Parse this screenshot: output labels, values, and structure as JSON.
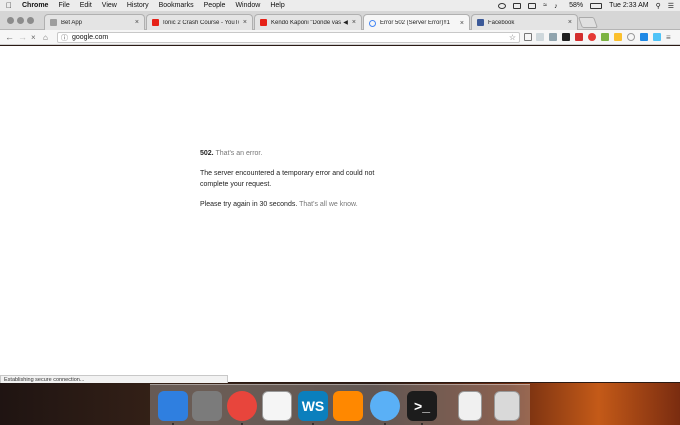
{
  "menubar": {
    "app": "Chrome",
    "menus": [
      "File",
      "Edit",
      "View",
      "History",
      "Bookmarks",
      "People",
      "Window",
      "Help"
    ],
    "battery": "58%",
    "clock": "Tue 2:33 AM"
  },
  "tabs": [
    {
      "title": "Bet App",
      "favicon_color": "#9e9e9e"
    },
    {
      "title": "Ionic 2 Crash Course - YouTub",
      "favicon_color": "#e62117"
    },
    {
      "title": "Kendo Kaponi \"Donde vas c",
      "favicon_color": "#e62117"
    },
    {
      "title": "Error 502 (Server Error)!!1",
      "favicon_color": "#4285f4",
      "active": true
    },
    {
      "title": "Facebook",
      "favicon_color": "#3b5998"
    }
  ],
  "toolbar": {
    "url": "google.com"
  },
  "error": {
    "code": "502.",
    "code_note": "That's an error.",
    "message": "The server encountered a temporary error and could not complete your request.",
    "retry": "Please try again in 30 seconds.",
    "retry_note": "That's all we know."
  },
  "status_bar": "Establishing secure connection...",
  "dock": {
    "apps": [
      {
        "icon": "finder-icon",
        "color": "#2f7fe0"
      },
      {
        "icon": "system-preferences-icon",
        "color": "#7b7b7b"
      },
      {
        "icon": "chrome-icon",
        "color": "#e8453c"
      },
      {
        "icon": "textedit-icon",
        "color": "#f5f5f5"
      },
      {
        "icon": "webstorm-icon",
        "color": "#0b7fbd"
      },
      {
        "icon": "vlc-icon",
        "color": "#ff8800"
      },
      {
        "icon": "messages-icon",
        "color": "#5ab0f6"
      },
      {
        "icon": "terminal-icon",
        "color": "#1c1c1c"
      },
      {
        "icon": "document-icon",
        "color": "#f0f0f0"
      },
      {
        "icon": "trash-icon",
        "color": "#d9d9d9"
      }
    ]
  }
}
